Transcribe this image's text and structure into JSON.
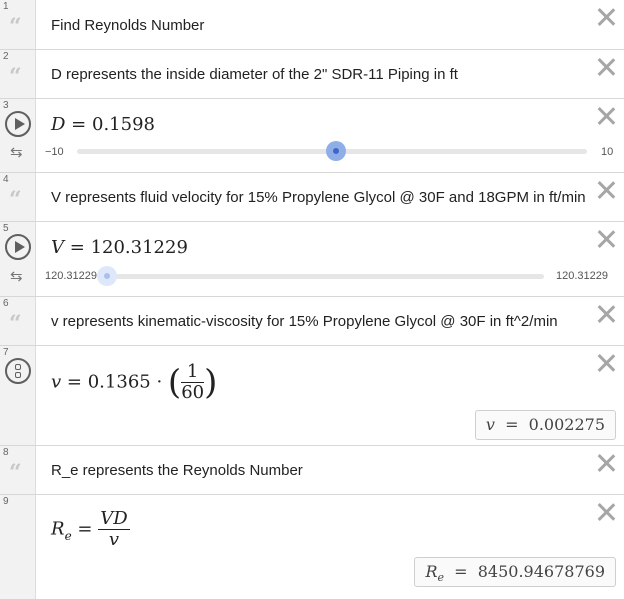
{
  "rows": [
    {
      "num": "1",
      "text": "Find Reynolds Number"
    },
    {
      "num": "2",
      "text": "D represents the inside diameter of the 2\" SDR-11 Piping in ft"
    },
    {
      "num": "3",
      "lhs": "D",
      "eq": "=",
      "value": "0.1598",
      "slider": {
        "min": "−10",
        "max": "10",
        "fraction": 0.508
      }
    },
    {
      "num": "4",
      "text": "V represents fluid velocity for 15% Propylene Glycol @ 30F and 18GPM in ft/min"
    },
    {
      "num": "5",
      "lhs": "V",
      "eq": "=",
      "value": "120.31229",
      "slider": {
        "min": "120.31229",
        "max": "120.31229",
        "fraction": 0.0
      }
    },
    {
      "num": "6",
      "text": "v represents kinematic-viscosity for 15% Propylene Glycol @ 30F in ft^2/min"
    },
    {
      "num": "7",
      "lhs": "v",
      "eq": "=",
      "coef": "0.1365",
      "dot": "·",
      "frac_num": "1",
      "frac_den": "60",
      "result_lhs": "v",
      "result_eq": "=",
      "result": "0.002275"
    },
    {
      "num": "8",
      "text": "R_e represents the Reynolds Number"
    },
    {
      "num": "9",
      "lhs": "R",
      "lhs_sub": "e",
      "eq": "=",
      "frac_num": "VD",
      "frac_den": "v",
      "result_lhs": "R",
      "result_sub": "e",
      "result_eq": "=",
      "result": "8450.94678769"
    }
  ],
  "icons": {
    "note": "quote-icon",
    "play": "play-icon",
    "loop": "loop-icon",
    "numeric": "numeric-icon",
    "close": "close-icon"
  }
}
